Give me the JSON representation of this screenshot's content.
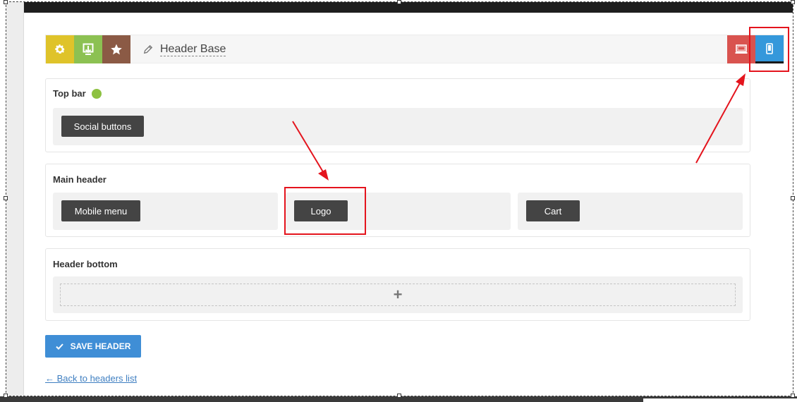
{
  "toolbar": {
    "title": "Header Base",
    "icons": {
      "settings": "gear-icon",
      "import": "import-icon",
      "presets": "star-icon",
      "edit": "pencil-icon",
      "desktop": "desktop-icon",
      "mobile": "mobile-icon"
    }
  },
  "sections": {
    "top_bar": {
      "title": "Top bar",
      "elements": [
        "Social buttons"
      ]
    },
    "main_header": {
      "title": "Main header",
      "left": "Mobile menu",
      "center": "Logo",
      "right": "Cart"
    },
    "header_bottom": {
      "title": "Header bottom",
      "add_symbol": "+"
    }
  },
  "actions": {
    "save_label": "SAVE HEADER",
    "back_label": "← Back to headers list"
  },
  "colors": {
    "gear": "#dfc32a",
    "import": "#8cc152",
    "star": "#8b5a45",
    "desktop": "#d9534f",
    "mobile": "#3498db",
    "save": "#3f8ed6",
    "annotation": "#e4141d",
    "status_dot": "#8dc141"
  }
}
